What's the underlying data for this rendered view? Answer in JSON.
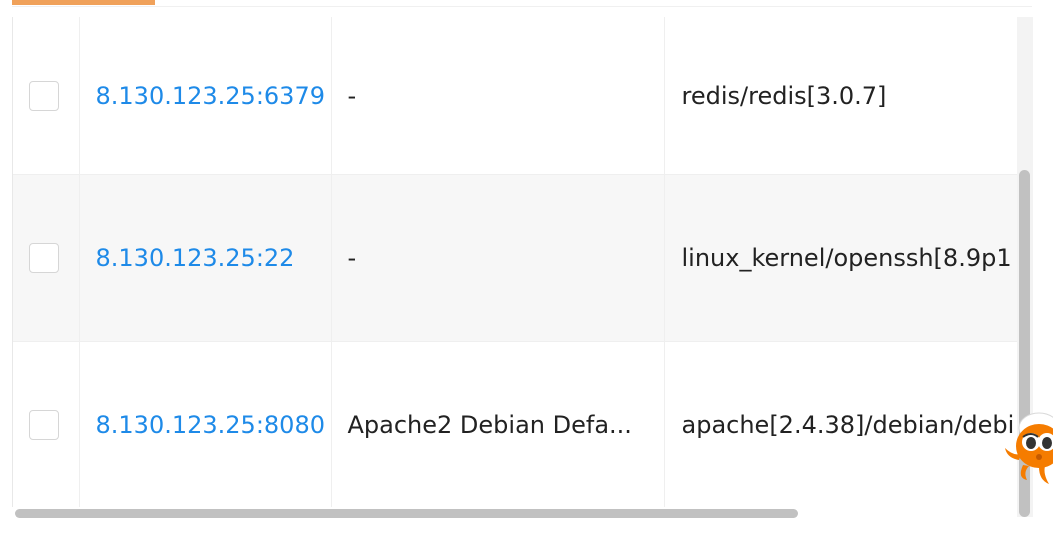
{
  "table": {
    "rows": [
      {
        "host": "8.130.123.25:6379",
        "title": "-",
        "product": "redis/redis[3.0.7]"
      },
      {
        "host": "8.130.123.25:22",
        "title": "-",
        "product": "linux_kernel/openssh[8.9p1"
      },
      {
        "host": "8.130.123.25:8080",
        "title": "Apache2 Debian Defa...",
        "product": "apache[2.4.38]/debian/debi"
      }
    ]
  },
  "colors": {
    "link": "#1e8ae8",
    "tab_accent": "#f0a15a",
    "mascot": "#f57c00"
  },
  "icons": {
    "mascot": "octopus-mascot-icon"
  }
}
